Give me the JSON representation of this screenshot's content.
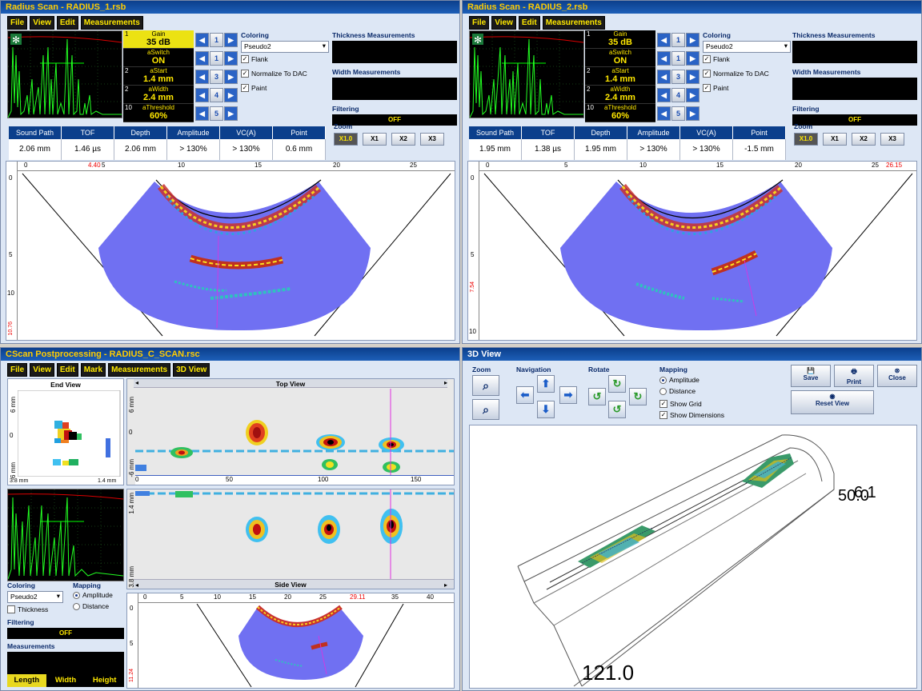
{
  "radius1": {
    "title": "Radius Scan - RADIUS_1.rsb",
    "menu": [
      "File",
      "View",
      "Edit",
      "Measurements"
    ],
    "params": [
      {
        "num": "1",
        "label": "Gain",
        "value": "35 dB"
      },
      {
        "num": "",
        "label": "aSwitch",
        "value": "ON"
      },
      {
        "num": "2",
        "label": "aStart",
        "value": "1.4 mm"
      },
      {
        "num": "2",
        "label": "aWidth",
        "value": "2.4 mm"
      },
      {
        "num": "10",
        "label": "aThreshold",
        "value": "60%"
      }
    ],
    "arrow_labels": [
      "1",
      "1",
      "3",
      "4",
      "5"
    ],
    "coloring_label": "Coloring",
    "coloring_value": "Pseudo2",
    "flank": "Flank",
    "normalize": "Normalize To DAC",
    "paint": "Paint",
    "thickness": "Thickness Measurements",
    "width": "Width Measurements",
    "filtering": "Filtering",
    "filter_value": "OFF",
    "meas_headers": [
      "Sound Path",
      "TOF",
      "Depth",
      "Amplitude",
      "VC(A)",
      "Point"
    ],
    "meas_values": [
      "2.06 mm",
      "1.46 µs",
      "2.06 mm",
      "> 130%",
      "> 130%",
      "0.6 mm"
    ],
    "zoom_label": "Zoom",
    "zoom": [
      "X1.0",
      "X1",
      "X2",
      "X3"
    ],
    "ruler_top": [
      "0",
      "5",
      "10",
      "15",
      "20",
      "25"
    ],
    "ruler_marker": "4.40",
    "ruler_left": [
      "0",
      "5",
      "10"
    ],
    "ruler_left_marker": "10.76"
  },
  "radius2": {
    "title": "Radius Scan - RADIUS_2.rsb",
    "menu": [
      "File",
      "View",
      "Edit",
      "Measurements"
    ],
    "params": [
      {
        "num": "1",
        "label": "Gain",
        "value": "35 dB"
      },
      {
        "num": "",
        "label": "aSwitch",
        "value": "ON"
      },
      {
        "num": "2",
        "label": "aStart",
        "value": "1.4 mm"
      },
      {
        "num": "2",
        "label": "aWidth",
        "value": "2.4 mm"
      },
      {
        "num": "10",
        "label": "aThreshold",
        "value": "60%"
      }
    ],
    "arrow_labels": [
      "1",
      "1",
      "3",
      "4",
      "5"
    ],
    "coloring_label": "Coloring",
    "coloring_value": "Pseudo2",
    "flank": "Flank",
    "normalize": "Normalize To DAC",
    "paint": "Paint",
    "thickness": "Thickness Measurements",
    "width": "Width Measurements",
    "filtering": "Filtering",
    "filter_value": "OFF",
    "meas_headers": [
      "Sound Path",
      "TOF",
      "Depth",
      "Amplitude",
      "VC(A)",
      "Point"
    ],
    "meas_values": [
      "1.95 mm",
      "1.38 µs",
      "1.95 mm",
      "> 130%",
      "> 130%",
      "-1.5 mm"
    ],
    "zoom_label": "Zoom",
    "zoom": [
      "X1.0",
      "X1",
      "X2",
      "X3"
    ],
    "ruler_top": [
      "0",
      "5",
      "10",
      "15",
      "20",
      "25"
    ],
    "ruler_marker": "26.15",
    "ruler_left": [
      "0",
      "5",
      "10"
    ],
    "ruler_left_marker": "7.54"
  },
  "cscan": {
    "title": "CScan Postprocessing - RADIUS_C_SCAN.rsc",
    "menu": [
      "File",
      "View",
      "Edit",
      "Mark",
      "Measurements",
      "3D View"
    ],
    "end_view": "End View",
    "top_view": "Top View",
    "side_view": "Side View",
    "end_left_top": "6 mm",
    "end_left_mid": "0",
    "end_left_bot": "-6 mm",
    "end_bot_left": "3.8 mm",
    "end_bot_right": "1.4 mm",
    "top_left_top": "6 mm",
    "top_left_mid": "0",
    "top_left_bot": "-6 mm",
    "top_axis": [
      "0",
      "50",
      "100",
      "150"
    ],
    "side_left_top": "1.4 mm",
    "side_left_bot": "3.8 mm",
    "coloring_label": "Coloring",
    "coloring_value": "Pseudo2",
    "thickness": "Thickness",
    "mapping_label": "Mapping",
    "amplitude": "Amplitude",
    "distance": "Distance",
    "filtering": "Filtering",
    "filter_value": "OFF",
    "measurements": "Measurements",
    "tabs": [
      "Length",
      "Width",
      "Height"
    ],
    "ruler_top": [
      "0",
      "5",
      "10",
      "15",
      "20",
      "25",
      "35",
      "40"
    ],
    "ruler_marker": "29.11",
    "ruler_left": [
      "0",
      "5"
    ],
    "ruler_left_marker": "11.24"
  },
  "view3d": {
    "title": "3D View",
    "zoom": "Zoom",
    "navigation": "Navigation",
    "rotate": "Rotate",
    "mapping": "Mapping",
    "amplitude": "Amplitude",
    "distance": "Distance",
    "show_grid": "Show Grid",
    "show_dims": "Show Dimensions",
    "save": "Save",
    "print": "Print",
    "close": "Close",
    "reset": "Reset View",
    "dim1": "50.0",
    "dim2": "6.1",
    "dim3": "121.0"
  }
}
